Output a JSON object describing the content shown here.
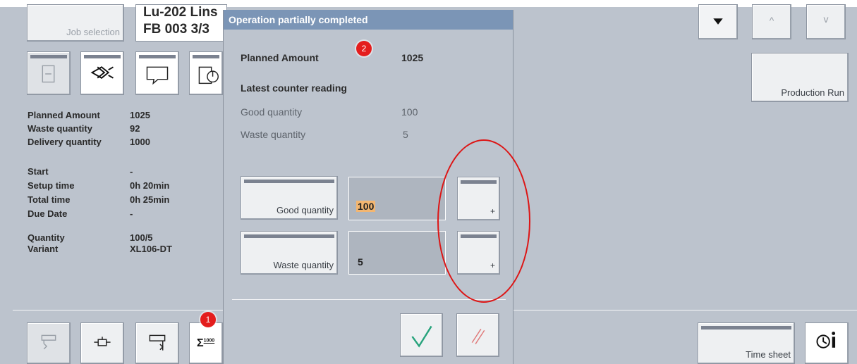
{
  "header": {
    "job_selection_label": "Job selection",
    "job_line1": "Lu-202 Lins",
    "job_line2": "FB 003  3/3",
    "hidden_fragment": "..."
  },
  "toolbar_left": {
    "icons": [
      "document-icon",
      "eye-direction-icon",
      "speech-bubble-icon",
      "pie-chart-icon"
    ]
  },
  "right_buttons": {
    "production_run": "Production Run",
    "dropdown_icon": "triangle-down-icon",
    "up_label": "^",
    "down_label": "v"
  },
  "info": {
    "rows": [
      {
        "label": "Planned Amount",
        "value": "1025"
      },
      {
        "label": "Waste quantity",
        "value": "92"
      },
      {
        "label": "Delivery quantity",
        "value": "1000"
      },
      {
        "label": "Start",
        "value": "-"
      },
      {
        "label": "Setup time",
        "value": "0h 20min"
      },
      {
        "label": "Total time",
        "value": "0h 25min"
      },
      {
        "label": "Due Date",
        "value": "-"
      },
      {
        "label": "Quantity",
        "value": "100/5"
      },
      {
        "label": "Variant",
        "value": "XL106-DT"
      }
    ]
  },
  "bottom_bar": {
    "time_sheet": "Time sheet",
    "sigma_label": "Σ",
    "sigma_sup": "1000",
    "info_icon": "clock-info-icon"
  },
  "dialog": {
    "title": "Operation partially completed",
    "planned_amount_label": "Planned Amount",
    "planned_amount_value": "1025",
    "latest_counter_label": "Latest counter reading",
    "good_quantity_label": "Good quantity",
    "good_quantity_reading": "100",
    "waste_quantity_label": "Waste quantity",
    "waste_quantity_reading": "5",
    "good_button_label": "Good quantity",
    "good_input_value": "100",
    "waste_button_label": "Waste quantity",
    "waste_input_value": "5",
    "plus_label": "+",
    "confirm_icon": "checkmark-icon",
    "cancel_icon": "cancel-slashes-icon"
  },
  "annotations": {
    "badge1": "1",
    "badge2": "2",
    "colors": {
      "badge": "#e41d1d",
      "oval": "#dd1515",
      "title_bar": "#7b95b6"
    }
  }
}
